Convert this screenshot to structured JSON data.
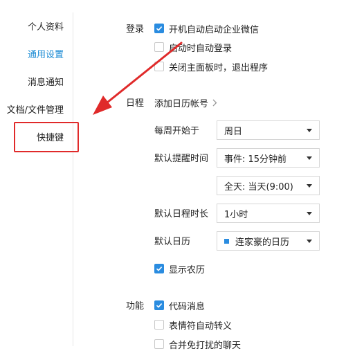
{
  "sidebar": {
    "items": [
      {
        "label": "个人资料",
        "active": false
      },
      {
        "label": "通用设置",
        "active": true
      },
      {
        "label": "消息通知",
        "active": false
      },
      {
        "label": "文档/文件管理",
        "active": false
      },
      {
        "label": "快捷键",
        "active": false
      }
    ]
  },
  "login": {
    "label": "登录",
    "options": [
      {
        "text": "开机自动启动企业微信",
        "checked": true
      },
      {
        "text": "启动时自动登录",
        "checked": false
      },
      {
        "text": "关闭主面板时，退出程序",
        "checked": false
      }
    ]
  },
  "schedule": {
    "label": "日程",
    "add_account": "添加日历帐号",
    "week_start_label": "每周开始于",
    "week_start_value": "周日",
    "reminder_label": "默认提醒时间",
    "reminder_event_value": "事件: 15分钟前",
    "reminder_allday_value": "全天: 当天(9:00)",
    "duration_label": "默认日程时长",
    "duration_value": "1小时",
    "calendar_label": "默认日历",
    "calendar_value": "连家豪的日历",
    "show_lunar": {
      "text": "显示农历",
      "checked": true
    }
  },
  "features": {
    "label": "功能",
    "options": [
      {
        "text": "代码消息",
        "checked": true
      },
      {
        "text": "表情符自动转义",
        "checked": false
      },
      {
        "text": "合并免打扰的聊天",
        "checked": false
      }
    ]
  },
  "colors": {
    "accent": "#1b8bd4",
    "checkbox": "#2a8ce0",
    "annotation": "#e02a2a"
  }
}
